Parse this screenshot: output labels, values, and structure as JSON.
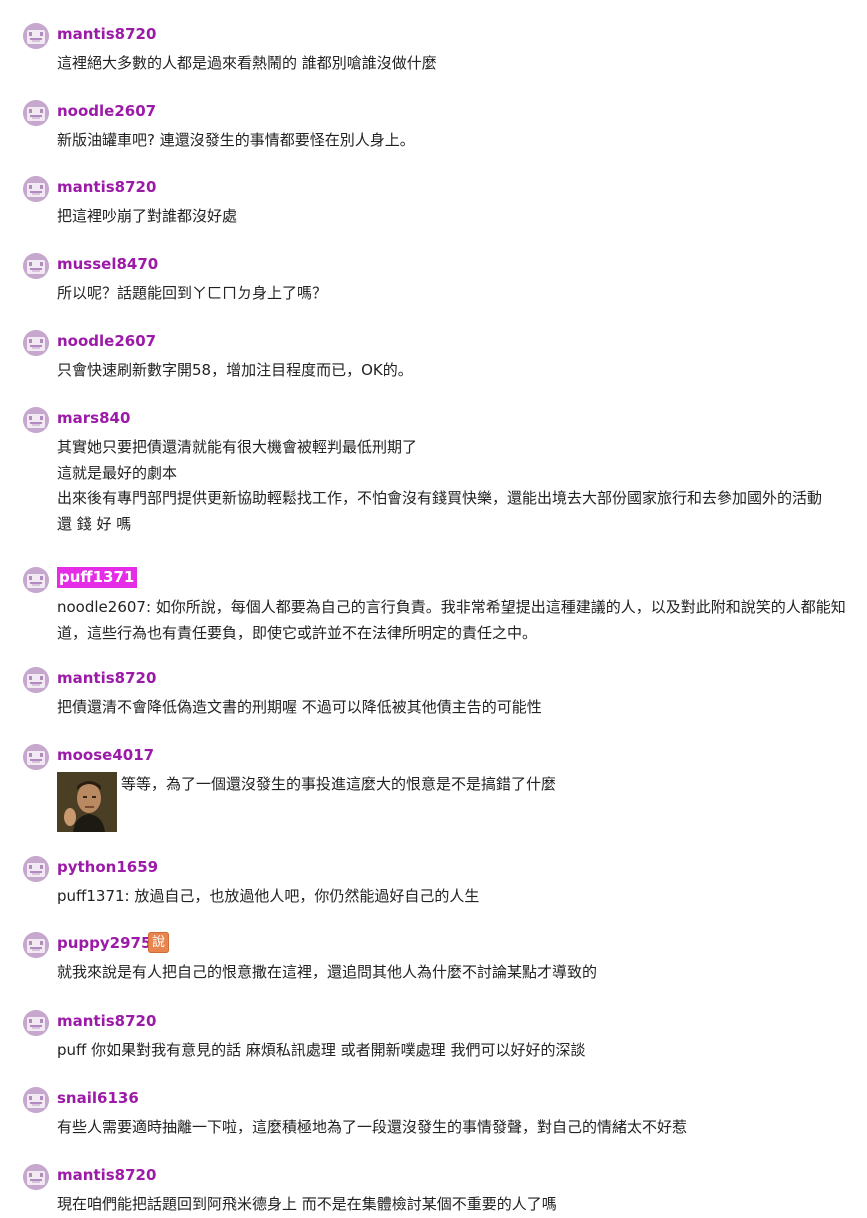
{
  "colors": {
    "username": "#9c1aa8",
    "highlight_bg": "#e52ce6",
    "badge_bg": "#e8844e",
    "avatar_bg": "#c2a4cc"
  },
  "comments": [
    {
      "user": "mantis8720",
      "lines": [
        "這裡絕大多數的人都是過來看熱鬧的 誰都別嗆誰沒做什麼"
      ]
    },
    {
      "user": "noodle2607",
      "lines": [
        "新版油罐車吧? 連還沒發生的事情都要怪在別人身上。"
      ]
    },
    {
      "user": "mantis8720",
      "lines": [
        "把這裡吵崩了對誰都沒好處"
      ]
    },
    {
      "user": "mussel8470",
      "lines": [
        "所以呢？話題能回到ㄚㄈㄇㄉ身上了嗎？"
      ]
    },
    {
      "user": "noodle2607",
      "lines": [
        "只會快速刷新數字開58，增加注目程度而已，OK的。"
      ]
    },
    {
      "user": "mars840",
      "lines": [
        "其實她只要把債還清就能有很大機會被輕判最低刑期了",
        "這就是最好的劇本",
        "出來後有專門部門提供更新協助輕鬆找工作，不怕會沒有錢買快樂，還能出境去大部份國家旅行和去參加國外的活動",
        "還 錢 好 嗎"
      ]
    },
    {
      "user": "puff1371",
      "highlight": true,
      "lines": [
        "noodle2607: 如你所說，每個人都要為自己的言行負責。我非常希望提出這種建議的人，以及對此附和說笑的人都能知道，這些行為也有責任要負，即使它或許並不在法律所明定的責任之中。"
      ]
    },
    {
      "user": "mantis8720",
      "lines": [
        "把債還清不會降低偽造文書的刑期喔 不過可以降低被其他債主告的可能性"
      ]
    },
    {
      "user": "moose4017",
      "image": "face-thumbnail",
      "lines": [
        "等等，為了一個還沒發生的事投進這麼大的恨意是不是搞錯了什麼"
      ]
    },
    {
      "user": "python1659",
      "lines": [
        "puff1371: 放過自己，也放過他人吧，你仍然能過好自己的人生"
      ]
    },
    {
      "user": "puppy2975",
      "badge": "說",
      "lines": [
        "就我來說是有人把自己的恨意撒在這裡，還追問其他人為什麼不討論某點才導致的"
      ]
    },
    {
      "user": "mantis8720",
      "lines": [
        "puff 你如果對我有意見的話 麻煩私訊處理 或者開新噗處理 我們可以好好的深談"
      ]
    },
    {
      "user": "snail6136",
      "lines": [
        "有些人需要適時抽離一下啦，這麼積極地為了一段還沒發生的事情發聲，對自己的情緒太不好惹"
      ]
    },
    {
      "user": "mantis8720",
      "lines": [
        "現在咱們能把話題回到阿飛米德身上 而不是在集體檢討某個不重要的人了嗎"
      ]
    }
  ]
}
